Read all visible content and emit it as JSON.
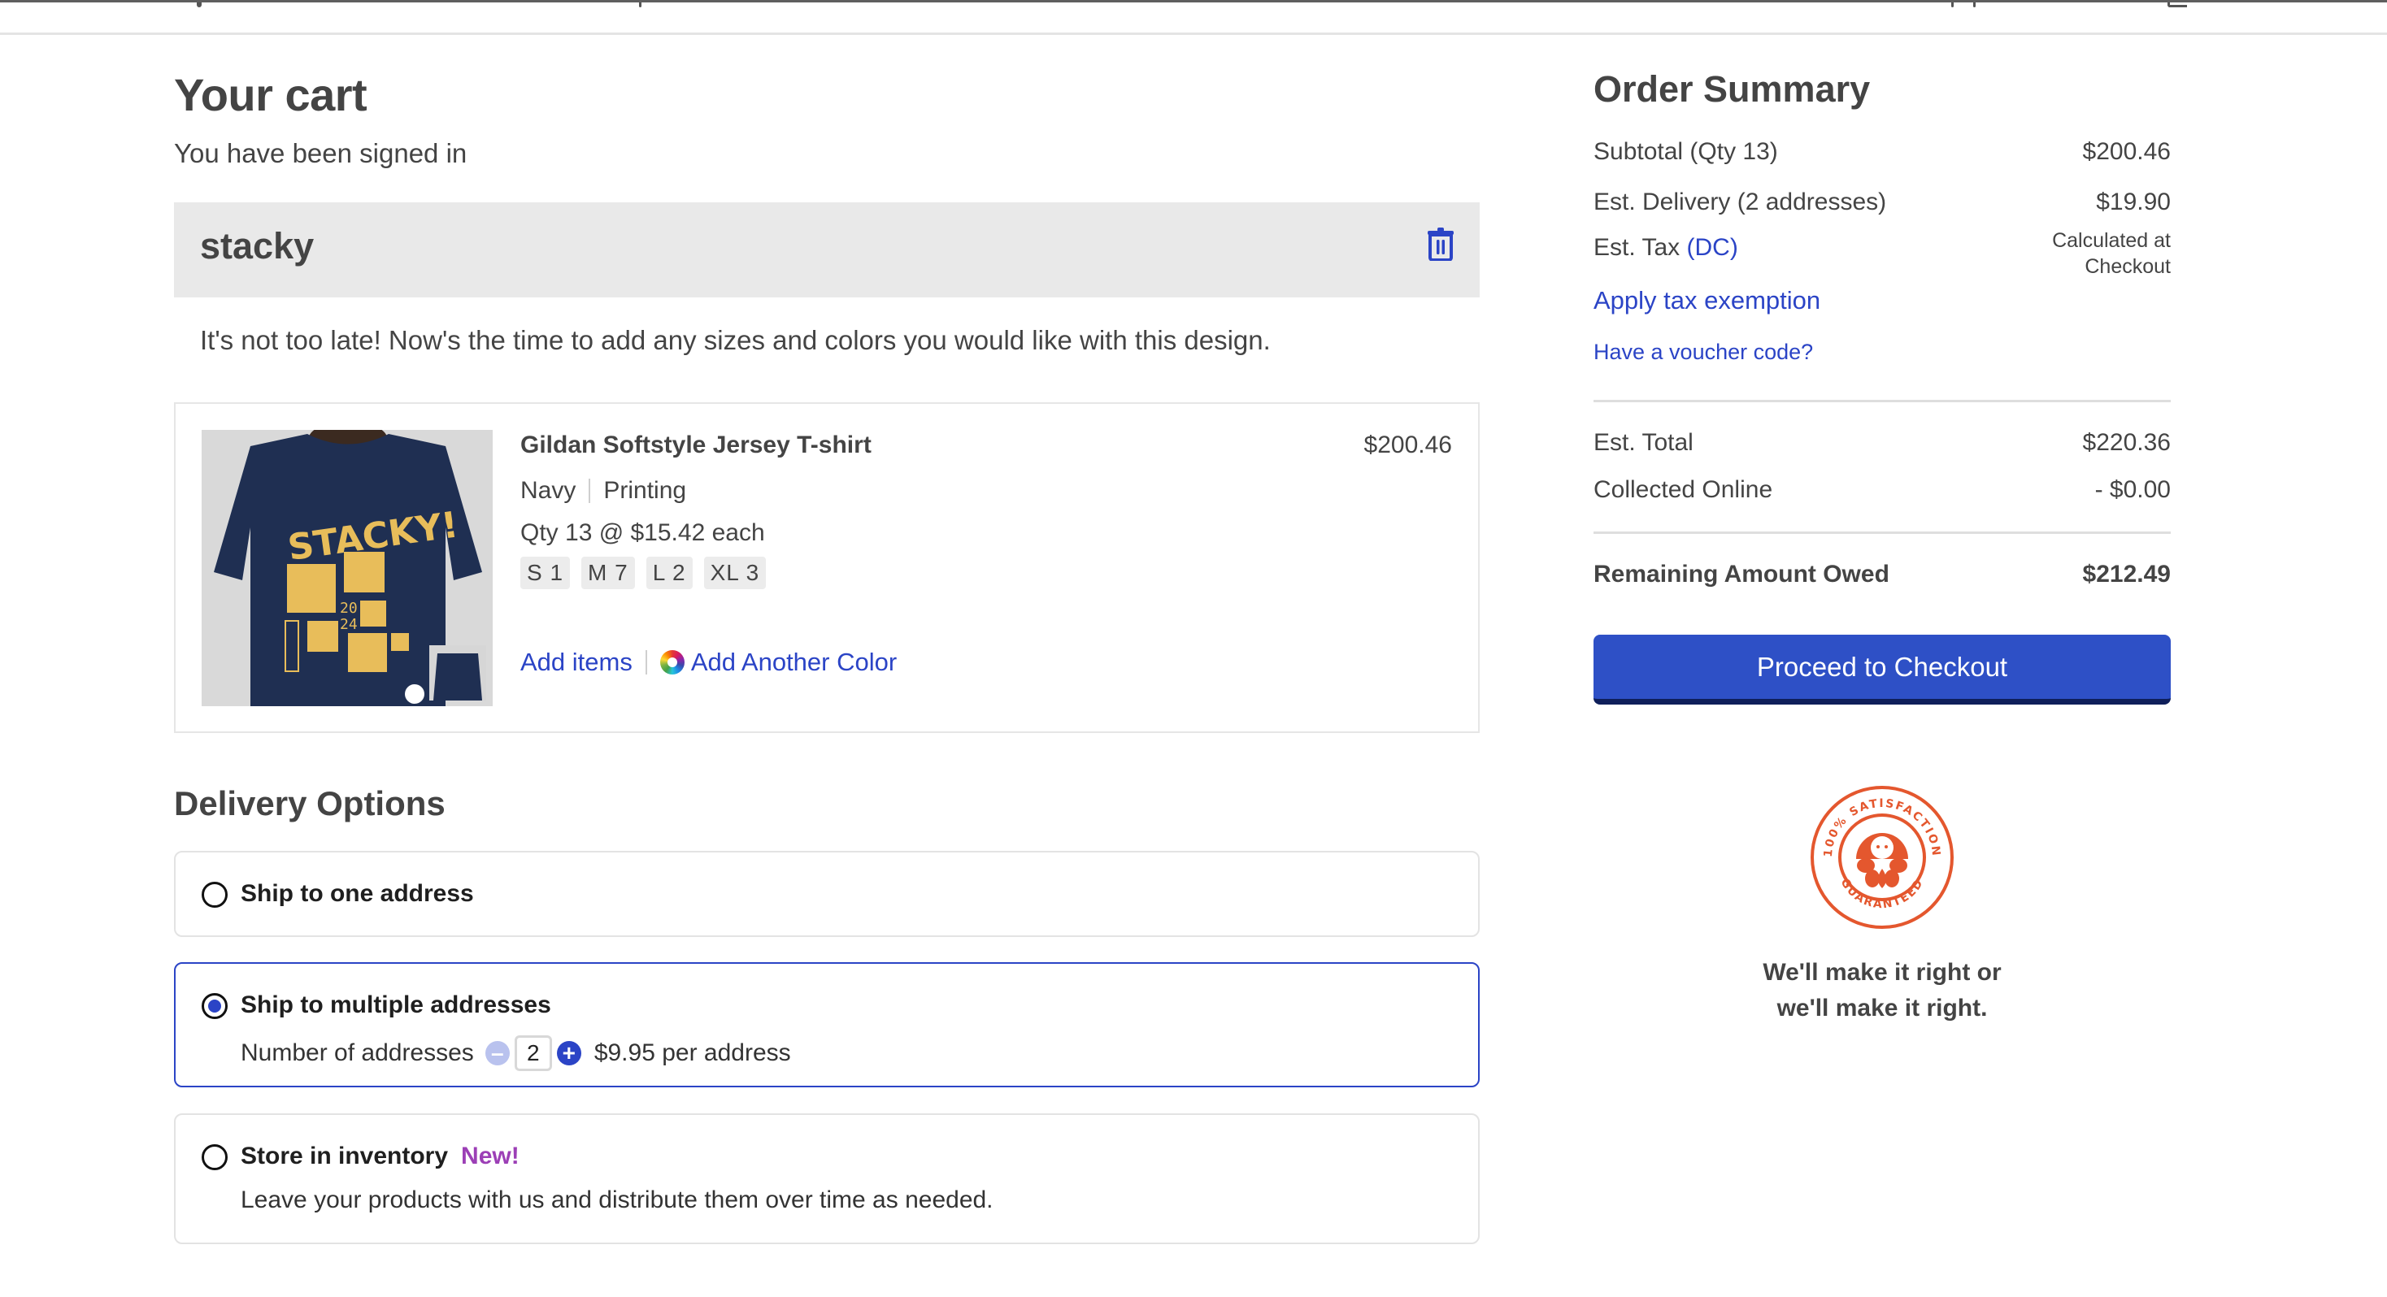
{
  "header": {
    "partial": true
  },
  "cart": {
    "title": "Your cart",
    "signed_in_message": "You have been signed in",
    "design": {
      "name": "stacky",
      "delete_icon": "trash-icon"
    },
    "tip": "It's not too late! Now's the time to add any sizes and colors you would like with this design.",
    "product": {
      "name": "Gildan Softstyle Jersey T-shirt",
      "color": "Navy",
      "decoration": "Printing",
      "qty_line": "Qty 13 @ $15.42 each",
      "price": "$200.46",
      "sizes": [
        {
          "label": "S 1"
        },
        {
          "label": "M 7"
        },
        {
          "label": "L 2"
        },
        {
          "label": "XL 3"
        }
      ],
      "image_alt": "Navy t-shirt with yellow STACKY! 2024 JSALT design",
      "add_items_label": "Add items",
      "add_color_label": "Add Another Color"
    }
  },
  "delivery": {
    "title": "Delivery Options",
    "options": [
      {
        "label": "Ship to one address",
        "selected": false
      },
      {
        "label": "Ship to multiple addresses",
        "selected": true,
        "addresses_label": "Number of addresses",
        "addresses_count": "2",
        "price_note": "$9.95 per address"
      },
      {
        "label": "Store in inventory",
        "selected": false,
        "badge": "New!",
        "description": "Leave your products with us and distribute them over time as needed."
      }
    ]
  },
  "summary": {
    "title": "Order Summary",
    "subtotal_label": "Subtotal (Qty 13)",
    "subtotal_value": "$200.46",
    "delivery_label": "Est. Delivery (2 addresses)",
    "delivery_value": "$19.90",
    "tax_label": "Est. Tax",
    "tax_region": "(DC)",
    "tax_value_line1": "Calculated at",
    "tax_value_line2": "Checkout",
    "tax_exemption_link": "Apply tax exemption",
    "voucher_link": "Have a voucher code?",
    "total_label": "Est. Total",
    "total_value": "$220.36",
    "collected_label": "Collected Online",
    "collected_value": "- $0.00",
    "remaining_label": "Remaining Amount Owed",
    "remaining_value": "$212.49",
    "checkout_label": "Proceed to Checkout"
  },
  "guarantee": {
    "badge_top": "100% SATISFACTION",
    "badge_bottom": "GUARANTEED",
    "line1": "We'll make it right or",
    "line2": "we'll make it right."
  },
  "colors": {
    "accent": "#2b44c6",
    "checkout_button": "#2e50c6",
    "new_badge": "#9c3fb6",
    "guarantee": "#e4572e",
    "shirt": "#1f2f52",
    "print": "#e8bd5a"
  }
}
